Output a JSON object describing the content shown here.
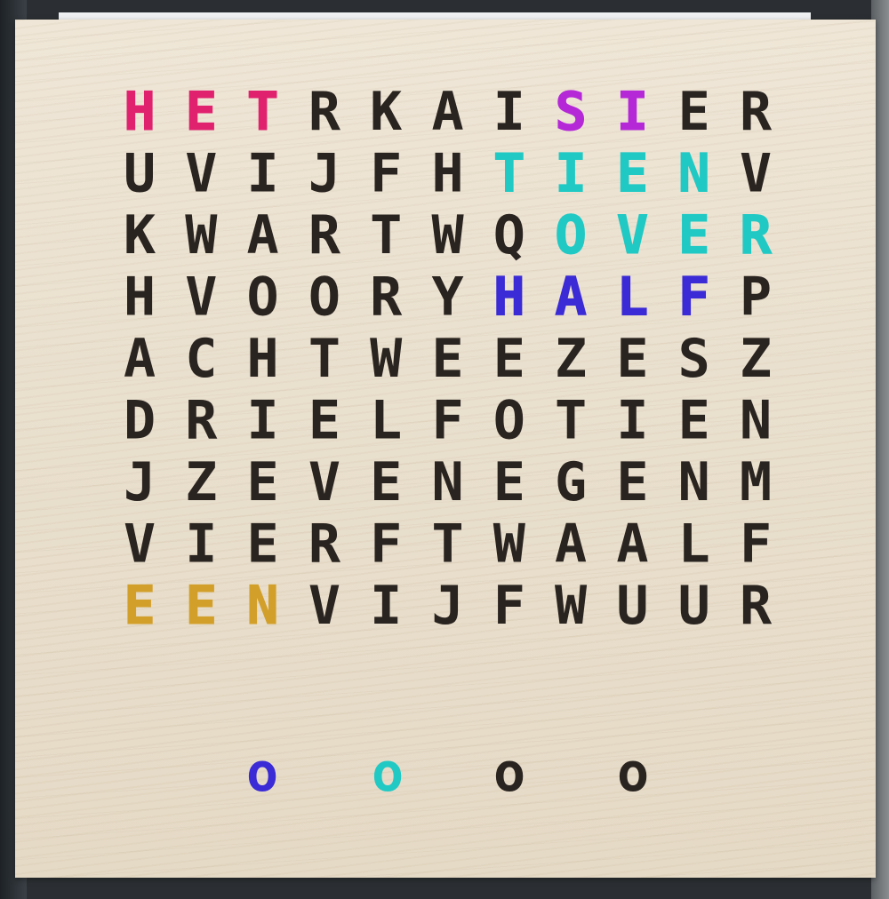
{
  "rows": [
    "HETRKAISIER",
    "UVIJFHTIENV",
    "KWARTWQOVER",
    "HVOORYHALFP",
    "ACHTWEEZESZ",
    "DRIELFOTIEN",
    "JZEVENEGENM",
    "VIERFTWAALF",
    "EENVIJFWUUR"
  ],
  "minute_dots": [
    {
      "symbol": "o",
      "lit": true,
      "color": "#3a2bd6"
    },
    {
      "symbol": "o",
      "lit": true,
      "color": "#21c9c4"
    },
    {
      "symbol": "o",
      "lit": false,
      "color": "#2a2420"
    },
    {
      "symbol": "o",
      "lit": false,
      "color": "#2a2420"
    }
  ],
  "colors": {
    "unlit": "#2a2420",
    "pink": "#e0226e",
    "violet": "#b428d8",
    "cyan": "#21c9c4",
    "blue": "#3a2bd6",
    "gold": "#d2a02a"
  },
  "highlights": [
    {
      "row": 0,
      "cols": [
        0,
        1,
        2
      ],
      "word": "HET",
      "color": "pink"
    },
    {
      "row": 0,
      "cols": [
        7,
        8
      ],
      "word": "IS",
      "color": "violet"
    },
    {
      "row": 1,
      "cols": [
        6,
        7,
        8,
        9
      ],
      "word": "TIEN",
      "color": "cyan"
    },
    {
      "row": 2,
      "cols": [
        7,
        8,
        9,
        10
      ],
      "word": "OVER",
      "color": "cyan"
    },
    {
      "row": 3,
      "cols": [
        6,
        7,
        8,
        9
      ],
      "word": "HALF",
      "color": "blue"
    },
    {
      "row": 8,
      "cols": [
        0,
        1,
        2
      ],
      "word": "EEN",
      "color": "gold"
    }
  ]
}
